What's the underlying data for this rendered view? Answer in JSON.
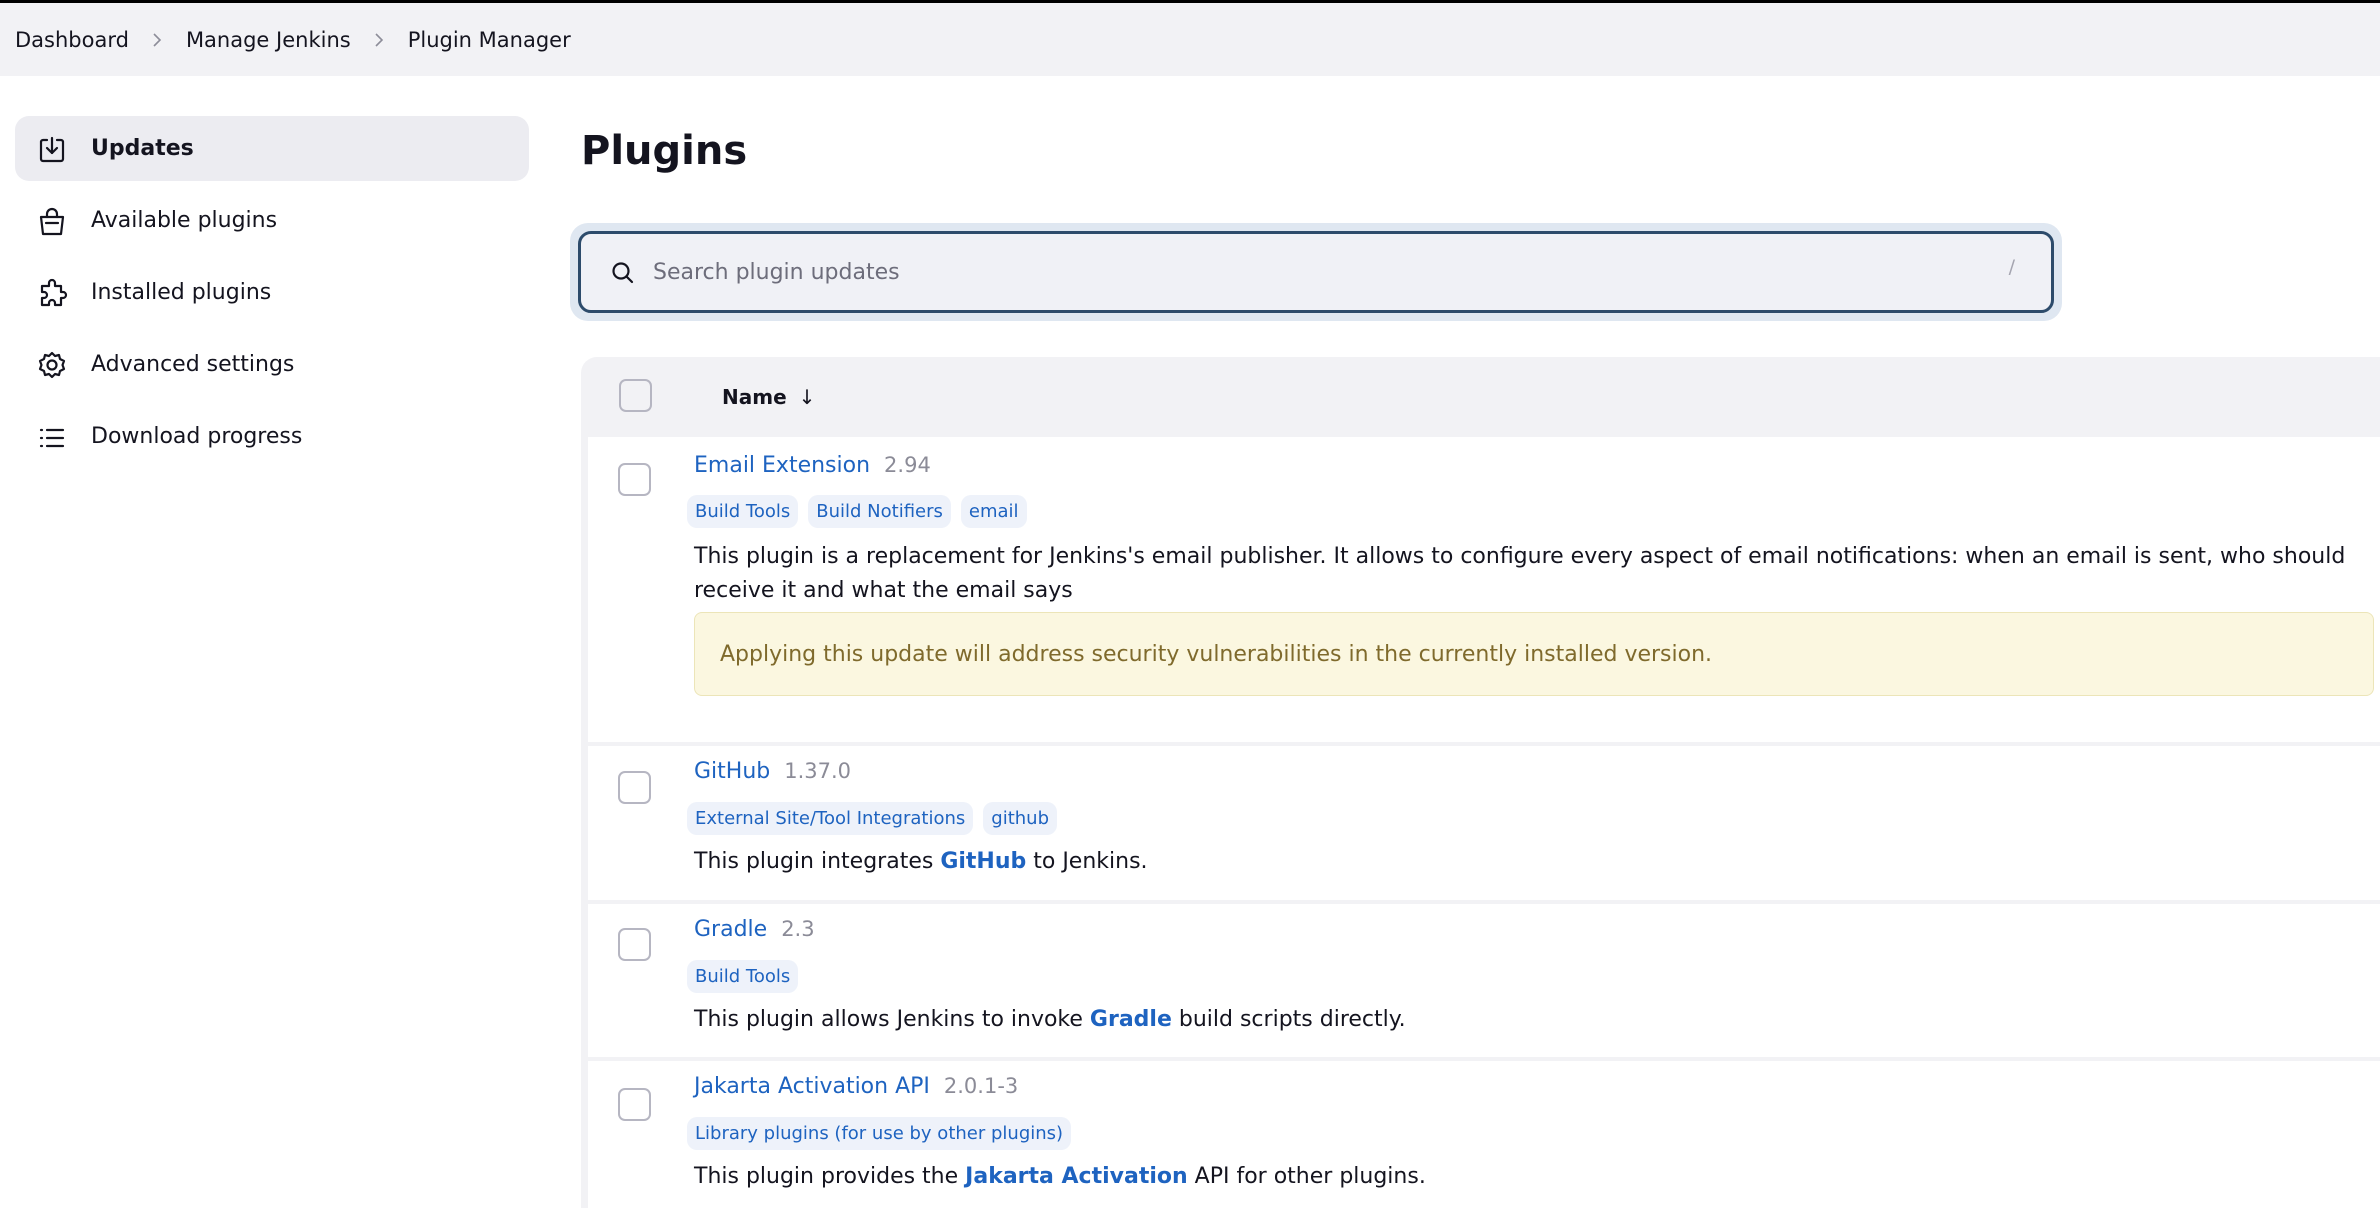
{
  "breadcrumb": [
    "Dashboard",
    "Manage Jenkins",
    "Plugin Manager"
  ],
  "sidebar": {
    "items": [
      {
        "label": "Updates",
        "icon": "download-icon",
        "active": true
      },
      {
        "label": "Available plugins",
        "icon": "shopping-bag-icon",
        "active": false
      },
      {
        "label": "Installed plugins",
        "icon": "puzzle-icon",
        "active": false
      },
      {
        "label": "Advanced settings",
        "icon": "gear-icon",
        "active": false
      },
      {
        "label": "Download progress",
        "icon": "list-icon",
        "active": false
      }
    ]
  },
  "main": {
    "title": "Plugins",
    "search": {
      "placeholder": "Search plugin updates",
      "value": "",
      "shortcut": "/"
    },
    "table": {
      "column_name": "Name",
      "sort_indicator": "↓",
      "plugins": [
        {
          "name": "Email Extension",
          "version": "2.94",
          "tags": [
            "Build Tools",
            "Build Notifiers",
            "email"
          ],
          "description": "This plugin is a replacement for Jenkins's email publisher. It allows to configure every aspect of email notifications: when an email is sent, who should receive it and what the email says",
          "warning": "Applying this update will address security vulnerabilities in the currently installed version."
        },
        {
          "name": "GitHub",
          "version": "1.37.0",
          "tags": [
            "External Site/Tool Integrations",
            "github"
          ],
          "description": {
            "before": "This plugin integrates ",
            "link": "GitHub",
            "after": " to Jenkins."
          }
        },
        {
          "name": "Gradle",
          "version": "2.3",
          "tags": [
            "Build Tools"
          ],
          "description": {
            "before": "This plugin allows Jenkins to invoke ",
            "link": "Gradle",
            "after": " build scripts directly."
          }
        },
        {
          "name": "Jakarta Activation API",
          "version": "2.0.1-3",
          "tags": [
            "Library plugins (for use by other plugins)"
          ],
          "description": {
            "before": "This plugin provides the ",
            "link": "Jakarta Activation",
            "after": " API for other plugins."
          }
        }
      ]
    }
  },
  "colors": {
    "link": "#1e63c0",
    "warning_bg": "#fbf7e0",
    "warning_text": "#7f6a2c",
    "search_border": "#2d4b6b"
  }
}
